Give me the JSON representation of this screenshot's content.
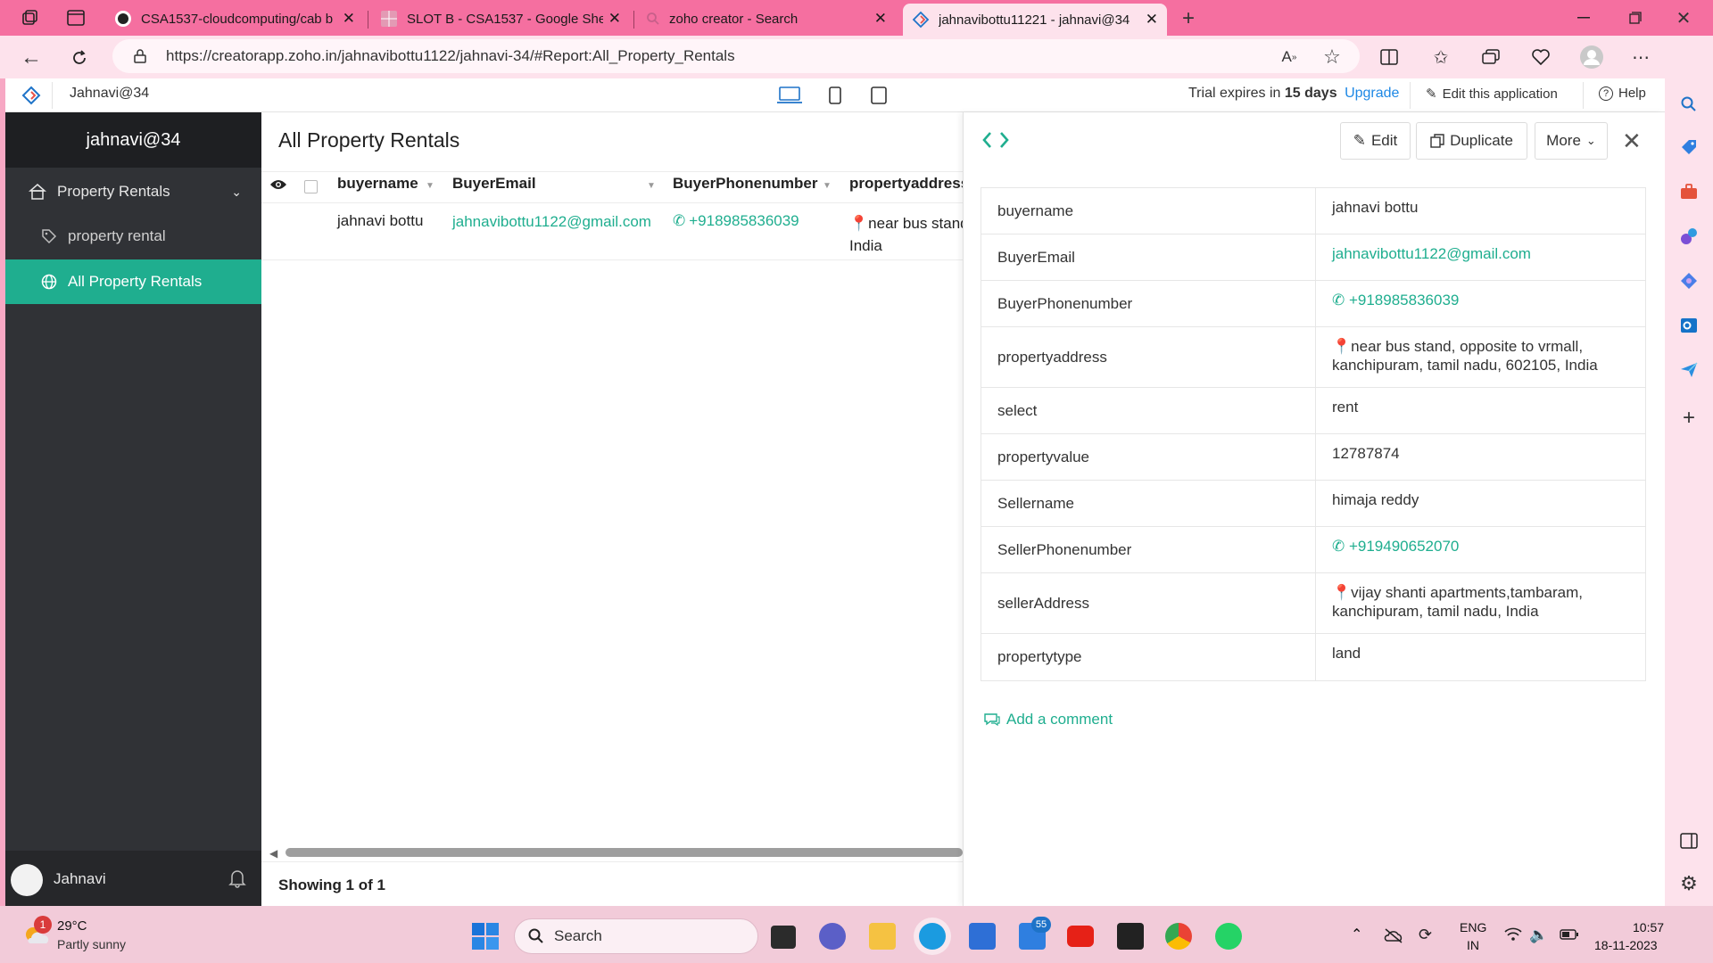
{
  "browser": {
    "tabs": [
      {
        "title": "CSA1537-cloudcomputing/cab b",
        "icon": "github-icon"
      },
      {
        "title": "SLOT B - CSA1537 - Google Shee",
        "icon": "sheets-icon"
      },
      {
        "title": "zoho creator - Search",
        "icon": "search-icon"
      },
      {
        "title": "jahnavibottu11221 - jahnavi@34",
        "icon": "zoho-icon",
        "active": true
      }
    ],
    "url": "https://creatorapp.zoho.in/jahnavibottu1122/jahnavi-34/#Report:All_Property_Rentals"
  },
  "apptop": {
    "workspace": "Jahnavi@34",
    "trial_prefix": "Trial expires in ",
    "trial_days": "15 days",
    "upgrade": "Upgrade",
    "edit_app": "Edit this application",
    "help": "Help"
  },
  "sidebar": {
    "app_name": "jahnavi@34",
    "section": "Property Rentals",
    "items": [
      {
        "label": "property rental"
      },
      {
        "label": "All Property Rentals",
        "active": true
      }
    ],
    "user": "Jahnavi"
  },
  "report": {
    "title": "All Property Rentals",
    "columns": [
      "buyername",
      "BuyerEmail",
      "BuyerPhonenumber",
      "propertyaddress"
    ],
    "row": {
      "buyername": "jahnavi bottu",
      "email": "jahnavibottu1122@gmail.com",
      "phone": "+918985836039",
      "address_line1": "near bus stand",
      "address_line2": "India"
    },
    "footer": "Showing 1 of 1"
  },
  "detail": {
    "buttons": {
      "edit": "Edit",
      "duplicate": "Duplicate",
      "more": "More"
    },
    "fields": [
      {
        "label": "buyername",
        "value": "jahnavi bottu"
      },
      {
        "label": "BuyerEmail",
        "value": "jahnavibottu1122@gmail.com",
        "kind": "link"
      },
      {
        "label": "BuyerPhonenumber",
        "value": "+918985836039",
        "kind": "phone"
      },
      {
        "label": "propertyaddress",
        "value": "near bus stand, opposite to vrmall,",
        "value2": "kanchipuram, tamil nadu, 602105, India",
        "kind": "address"
      },
      {
        "label": "select",
        "value": "rent"
      },
      {
        "label": "propertyvalue",
        "value": "12787874"
      },
      {
        "label": "Sellername",
        "value": "himaja reddy"
      },
      {
        "label": "SellerPhonenumber",
        "value": "+919490652070",
        "kind": "phone"
      },
      {
        "label": "sellerAddress",
        "value": "vijay shanti apartments,tambaram,",
        "value2": "kanchipuram, tamil nadu, India",
        "kind": "address"
      },
      {
        "label": "propertytype",
        "value": "land"
      }
    ],
    "add_comment": "Add a comment"
  },
  "taskbar": {
    "weather_temp": "29°C",
    "weather_desc": "Partly sunny",
    "weather_badge": "1",
    "search": "Search",
    "store_badge": "55",
    "lang1": "ENG",
    "lang2": "IN",
    "time": "10:57",
    "date": "18-11-2023"
  },
  "colors": {
    "accent": "#1fae8f",
    "sidebar": "#303236",
    "tabbar": "#f56fa0",
    "link": "#1e88e5"
  }
}
